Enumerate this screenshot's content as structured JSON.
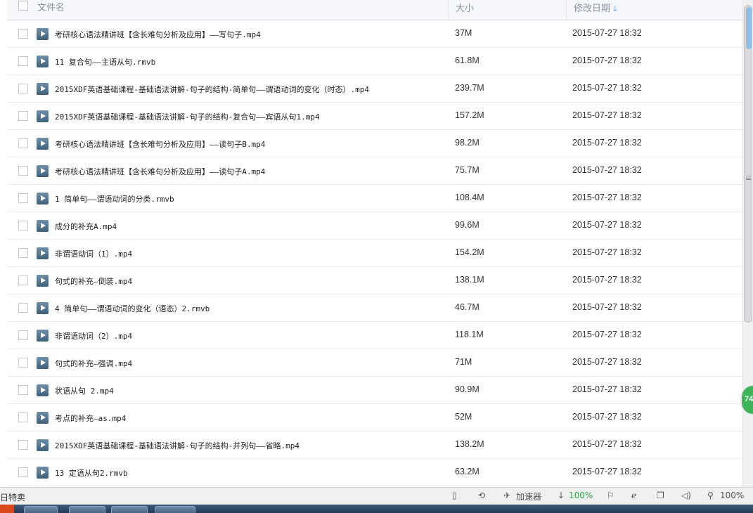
{
  "header": {
    "name_label": "文件名",
    "size_label": "大小",
    "date_label": "修改日期",
    "sort_icon": "arrow-down-icon"
  },
  "files": [
    {
      "name": "考研核心语法精讲班【含长难句分析及应用】——写句子.mp4",
      "size": "37M",
      "date": "2015-07-27 18:32"
    },
    {
      "name": "11 复合句——主语从句.rmvb",
      "size": "61.8M",
      "date": "2015-07-27 18:32"
    },
    {
      "name": "2015XDF英语基础课程-基础语法讲解-句子的结构-简单句——谓语动词的变化（时态）.mp4",
      "size": "239.7M",
      "date": "2015-07-27 18:32"
    },
    {
      "name": "2015XDF英语基础课程-基础语法讲解-句子的结构-复合句——宾语从句1.mp4",
      "size": "157.2M",
      "date": "2015-07-27 18:32"
    },
    {
      "name": "考研核心语法精讲班【含长难句分析及应用】——读句子B.mp4",
      "size": "98.2M",
      "date": "2015-07-27 18:32"
    },
    {
      "name": "考研核心语法精讲班【含长难句分析及应用】——读句子A.mp4",
      "size": "75.7M",
      "date": "2015-07-27 18:32"
    },
    {
      "name": "1 简单句——谓语动词的分类.rmvb",
      "size": "108.4M",
      "date": "2015-07-27 18:32"
    },
    {
      "name": "成分的补充A.mp4",
      "size": "99.6M",
      "date": "2015-07-27 18:32"
    },
    {
      "name": "非谓语动词（1）.mp4",
      "size": "154.2M",
      "date": "2015-07-27 18:32"
    },
    {
      "name": "句式的补充—倒装.mp4",
      "size": "138.1M",
      "date": "2015-07-27 18:32"
    },
    {
      "name": "4 简单句——谓语动词的变化（语态）2.rmvb",
      "size": "46.7M",
      "date": "2015-07-27 18:32"
    },
    {
      "name": "非谓语动词（2）.mp4",
      "size": "118.1M",
      "date": "2015-07-27 18:32"
    },
    {
      "name": "句式的补充—强调.mp4",
      "size": "71M",
      "date": "2015-07-27 18:32"
    },
    {
      "name": "状语从句 2.mp4",
      "size": "90.9M",
      "date": "2015-07-27 18:32"
    },
    {
      "name": "考点的补充—as.mp4",
      "size": "52M",
      "date": "2015-07-27 18:32"
    },
    {
      "name": "2015XDF英语基础课程-基础语法讲解-句子的结构-并列句——省略.mp4",
      "size": "138.2M",
      "date": "2015-07-27 18:32"
    },
    {
      "name": "13 定语从句2.rmvb",
      "size": "63.2M",
      "date": "2015-07-27 18:32"
    }
  ],
  "badge": "74",
  "statusbar": {
    "left_text": "日特卖",
    "accelerator": "加速器",
    "download_pct": "100%",
    "zoom": "100%"
  },
  "colors": {
    "accent": "#2e7fd6",
    "green": "#2aa84b",
    "file_icon": "#4f6f89"
  }
}
